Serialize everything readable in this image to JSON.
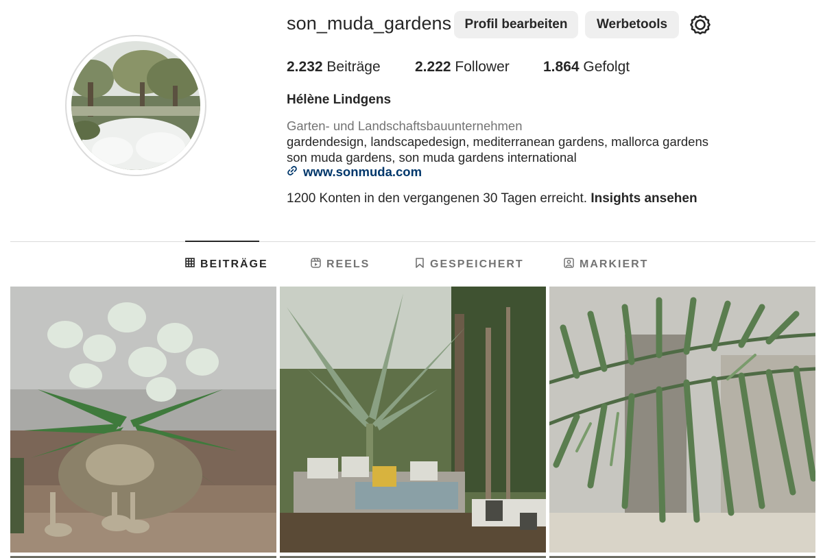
{
  "profile": {
    "username": "son_muda_gardens",
    "edit_button": "Profil bearbeiten",
    "tools_button": "Werbetools",
    "settings_icon": "gear-icon",
    "fullname": "Hélène Lindgens",
    "category": "Garten- und Landschaftsbauunternehmen",
    "bio_line1": "gardendesign, landscapedesign, mediterranean gardens, mallorca gardens",
    "bio_line2": "son muda gardens, son muda gardens international",
    "website": "www.sonmuda.com",
    "insights_text": "1200 Konten in den vergangenen 30 Tagen erreicht.",
    "insights_link": "Insights ansehen"
  },
  "stats": [
    {
      "value": "2.232",
      "label": "Beiträge"
    },
    {
      "value": "2.222",
      "label": "Follower"
    },
    {
      "value": "1.864",
      "label": "Gefolgt"
    }
  ],
  "tabs": [
    {
      "label": "BEITRÄGE",
      "icon": "grid-icon",
      "active": true
    },
    {
      "label": "REELS",
      "icon": "reels-icon",
      "active": false
    },
    {
      "label": "GESPEICHERT",
      "icon": "bookmark-icon",
      "active": false
    },
    {
      "label": "MARKIERT",
      "icon": "tagged-icon",
      "active": false
    }
  ],
  "colors": {
    "text": "#262626",
    "secondary": "#737373",
    "link": "#00376b",
    "button_bg": "#efefef",
    "divider": "#dbdbdb"
  }
}
